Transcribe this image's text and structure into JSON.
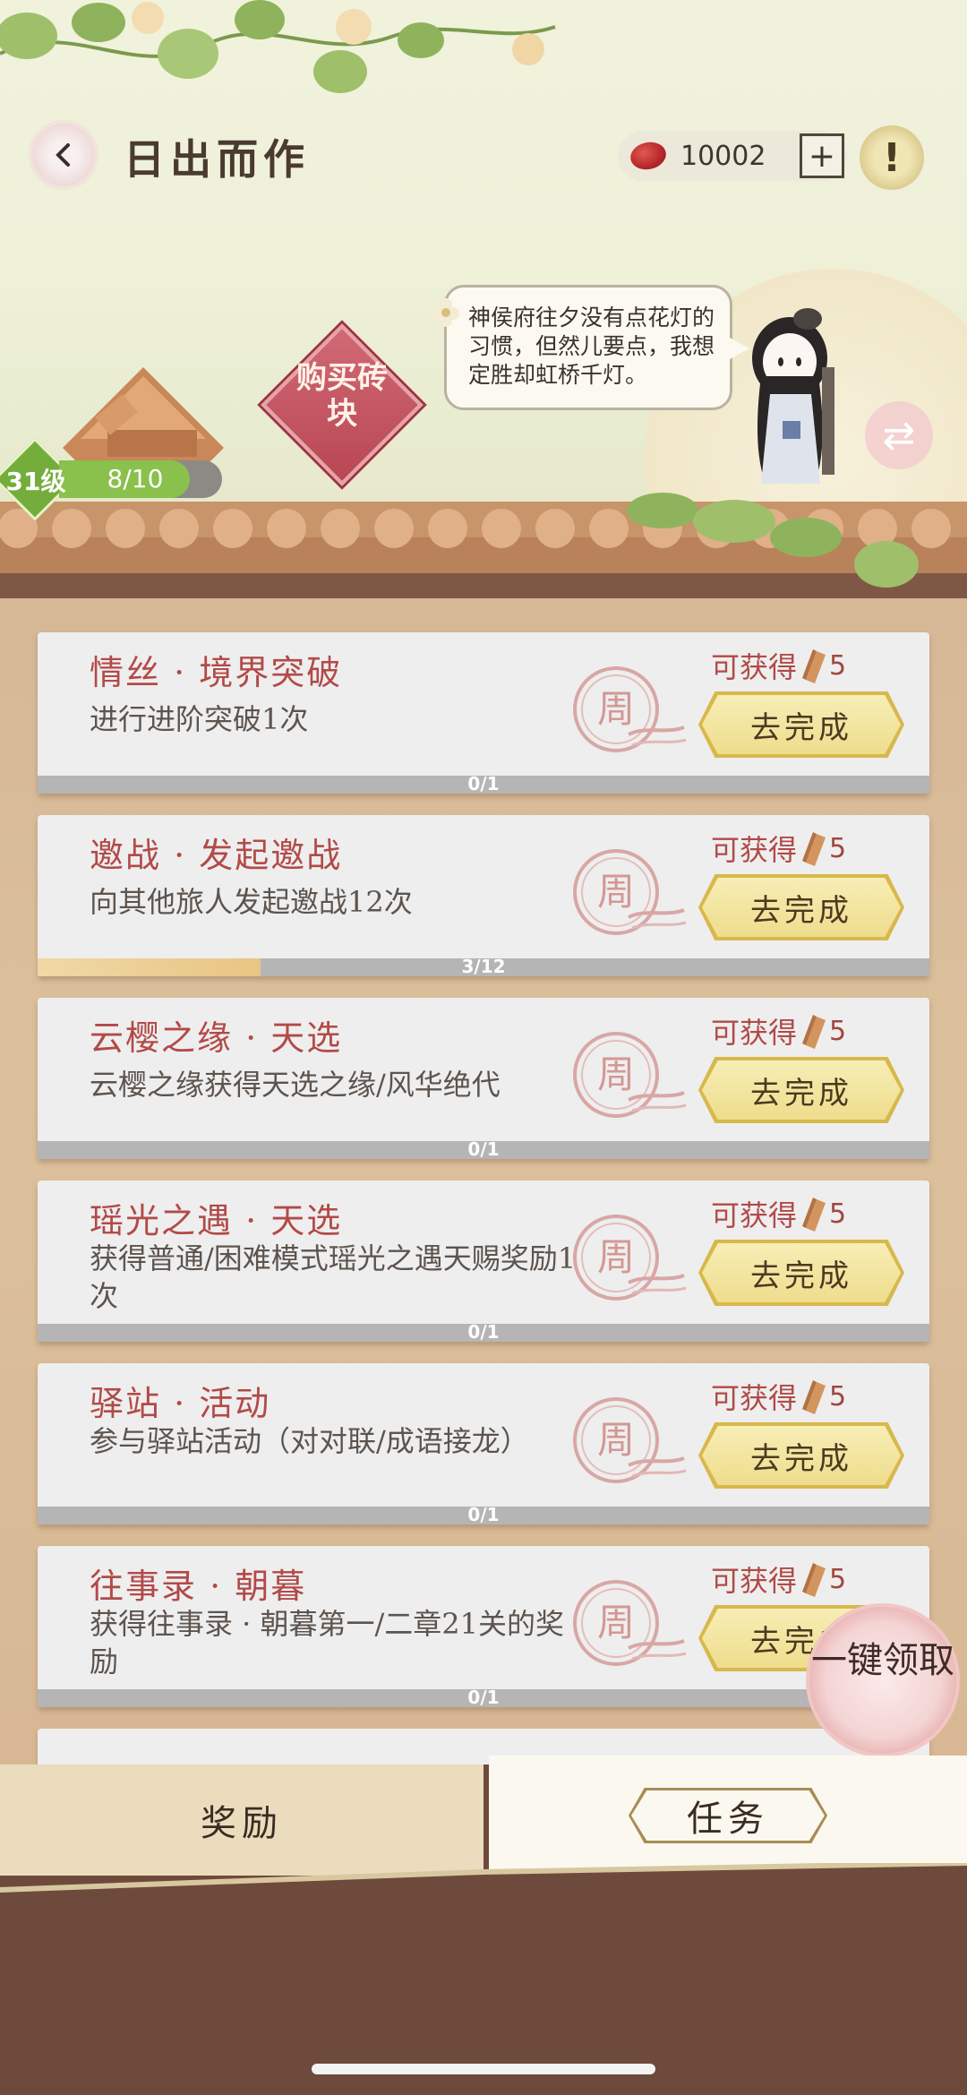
{
  "header": {
    "title": "日出而作",
    "currency_value": "10002",
    "plus_label": "+",
    "notice_label": "!"
  },
  "scene": {
    "speech_text": "神侯府往夕没有点花灯的习惯，但然儿要点，我想定胜却虹桥千灯。",
    "buy_bricks_label": "购买砖块",
    "level_label": "31级",
    "level_progress_text": "8/10",
    "level_progress_fraction": 0.8,
    "swap_label": "⇄"
  },
  "tasks": [
    {
      "title": "情丝 · 境界突破",
      "desc": "进行进阶突破1次",
      "reward_label": "可获得",
      "reward_value": "5",
      "button": "去完成",
      "progress_text": "0/1",
      "progress": 0,
      "seal": "周"
    },
    {
      "title": "邀战 · 发起邀战",
      "desc": "向其他旅人发起邀战12次",
      "reward_label": "可获得",
      "reward_value": "5",
      "button": "去完成",
      "progress_text": "3/12",
      "progress": 0.25,
      "seal": "周"
    },
    {
      "title": "云樱之缘 · 天选",
      "desc": "云樱之缘获得天选之缘/风华绝代",
      "reward_label": "可获得",
      "reward_value": "5",
      "button": "去完成",
      "progress_text": "0/1",
      "progress": 0,
      "seal": "周"
    },
    {
      "title": "瑶光之遇 · 天选",
      "desc": "获得普通/困难模式瑶光之遇天赐奖励1次",
      "reward_label": "可获得",
      "reward_value": "5",
      "button": "去完成",
      "progress_text": "0/1",
      "progress": 0,
      "seal": "周"
    },
    {
      "title": "驿站 · 活动",
      "desc": "参与驿站活动（对对联/成语接龙）",
      "reward_label": "可获得",
      "reward_value": "5",
      "button": "去完成",
      "progress_text": "0/1",
      "progress": 0,
      "seal": "周"
    },
    {
      "title": "往事录 · 朝暮",
      "desc": "获得往事录 · 朝暮第一/二章21关的奖励",
      "reward_label": "可获得",
      "reward_value": "5",
      "button": "去完成",
      "progress_text": "0/1",
      "progress": 0,
      "seal": "周"
    }
  ],
  "claim_all_label": "一键领取",
  "tabs": {
    "rewards": "奖励",
    "tasks": "任务"
  }
}
